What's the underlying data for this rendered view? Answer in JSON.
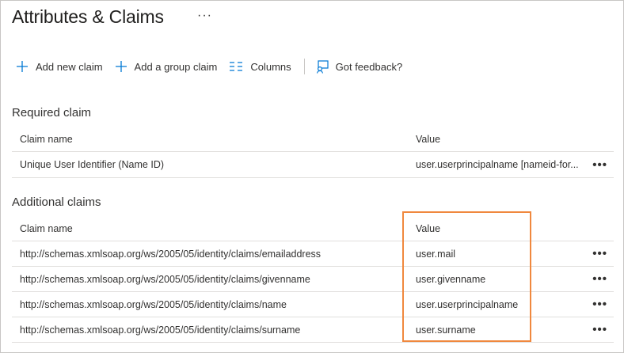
{
  "page": {
    "title": "Attributes & Claims",
    "more_glyph": "···"
  },
  "toolbar": {
    "add_claim": {
      "label": "Add new claim",
      "icon": "plus-icon"
    },
    "add_group_claim": {
      "label": "Add a group claim",
      "icon": "plus-icon"
    },
    "columns": {
      "label": "Columns",
      "icon": "columns-icon"
    },
    "feedback": {
      "label": "Got feedback?",
      "icon": "feedback-icon"
    }
  },
  "required": {
    "title": "Required claim",
    "headers": {
      "name": "Claim name",
      "value": "Value"
    },
    "rows": [
      {
        "name": "Unique User Identifier (Name ID)",
        "value": "user.userprincipalname [nameid-for..."
      }
    ]
  },
  "additional": {
    "title": "Additional claims",
    "headers": {
      "name": "Claim name",
      "value": "Value"
    },
    "rows": [
      {
        "name": "http://schemas.xmlsoap.org/ws/2005/05/identity/claims/emailaddress",
        "value": "user.mail"
      },
      {
        "name": "http://schemas.xmlsoap.org/ws/2005/05/identity/claims/givenname",
        "value": "user.givenname"
      },
      {
        "name": "http://schemas.xmlsoap.org/ws/2005/05/identity/claims/name",
        "value": "user.userprincipalname"
      },
      {
        "name": "http://schemas.xmlsoap.org/ws/2005/05/identity/claims/surname",
        "value": "user.surname"
      }
    ]
  },
  "row_more_glyph": "•••",
  "colors": {
    "accent": "#0078d4",
    "highlight": "#f0883e",
    "border": "#e1dfdd"
  }
}
